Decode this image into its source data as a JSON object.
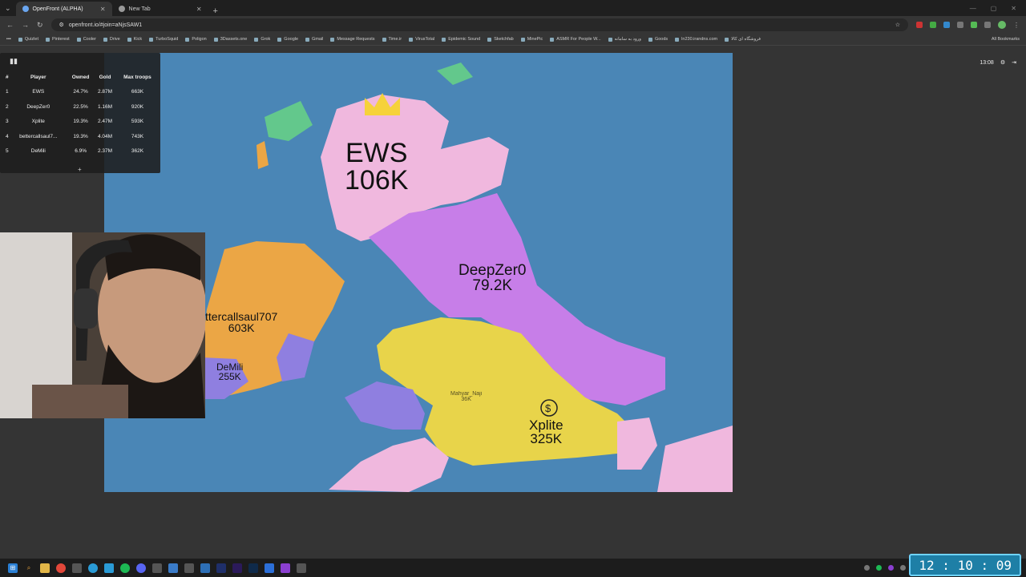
{
  "browser": {
    "tabs": [
      {
        "title": "OpenFront (ALPHA)"
      },
      {
        "title": "New Tab"
      }
    ],
    "url": "openfront.io/#join=aNjsSAW1",
    "bookmarks": [
      "Quizlet",
      "Pinterest",
      "Cooler",
      "Drive",
      "Kick",
      "TurboSquid",
      "Poligon",
      "3Dassets.one",
      "Grok",
      "Google",
      "Gmail",
      "Message Requests",
      "Time.ir",
      "VirusTotal",
      "Epidemic Sound",
      "Sketchfab",
      "MinePic",
      "ASMR For People W...",
      "ورود به سامانه",
      "Goods",
      "ln230.irandns.com",
      "فروشگاه ای کالا"
    ],
    "all_bookmarks": "All Bookmarks"
  },
  "game": {
    "timer": "13:08",
    "leaderboard": {
      "headers": [
        "#",
        "Player",
        "Owned",
        "Gold",
        "Max troops"
      ],
      "rows": [
        {
          "rank": "1",
          "player": "EWS",
          "owned": "24.7%",
          "gold": "2.87M",
          "troops": "663K"
        },
        {
          "rank": "2",
          "player": "DeepZer0",
          "owned": "22.5%",
          "gold": "1.16M",
          "troops": "920K"
        },
        {
          "rank": "3",
          "player": "Xplite",
          "owned": "19.3%",
          "gold": "2.47M",
          "troops": "593K"
        },
        {
          "rank": "4",
          "player": "bettercallsaul7...",
          "owned": "19.3%",
          "gold": "4.04M",
          "troops": "743K"
        },
        {
          "rank": "5",
          "player": "DeMili",
          "owned": "6.9%",
          "gold": "2.37M",
          "troops": "362K"
        }
      ],
      "expand": "+"
    },
    "map_labels": {
      "ews": {
        "name": "EWS",
        "troops": "106K"
      },
      "deepzer0": {
        "name": "DeepZer0",
        "troops": "79.2K"
      },
      "saul": {
        "name": "ttercallsaul707",
        "troops": "603K"
      },
      "demili": {
        "name": "DeMili",
        "troops": "255K"
      },
      "xplite": {
        "name": "Xplite",
        "troops": "325K"
      },
      "small": {
        "name": "Mahyar_Naji",
        "troops": "36K"
      }
    },
    "colors": {
      "ocean": "#4a86b6",
      "ews": "#f0b8de",
      "deepzer0": "#c77ee8",
      "xplite": "#e8d44a",
      "saul": "#eba645",
      "demili": "#8f7fe0",
      "neutral": "#63c88c"
    }
  },
  "taskbar": {
    "clock": "12 : 10 : 09"
  }
}
